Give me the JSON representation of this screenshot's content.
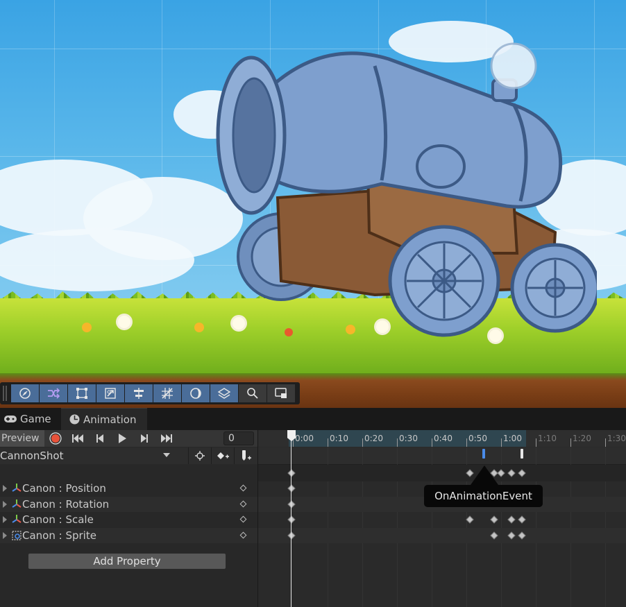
{
  "tabs": {
    "game_label": "Game",
    "animation_label": "Animation"
  },
  "scene_toolbar": {
    "tools": [
      "view-tool-icon",
      "move-tool-icon",
      "rect-tool-icon",
      "transform-tool-icon",
      "align-tool-icon",
      "grid-snap-icon",
      "shading-icon",
      "layers-icon",
      "search-icon",
      "camera-overlay-icon"
    ]
  },
  "animation": {
    "preview_label": "Preview",
    "frame_value": "0",
    "clip_name": "CannonShot",
    "properties": [
      {
        "label": "Canon : Position"
      },
      {
        "label": "Canon : Rotation"
      },
      {
        "label": "Canon : Scale"
      },
      {
        "label": "Canon : Sprite"
      }
    ],
    "add_property_label": "Add Property",
    "ruler_labels": [
      "0:00",
      "0:10",
      "0:20",
      "0:30",
      "0:40",
      "0:50",
      "1:00",
      "1:10",
      "1:20",
      "1:30"
    ],
    "tooltip": "OnAnimationEvent"
  },
  "colors": {
    "accent_blue": "#4a6d99",
    "record_red": "#e8523a",
    "event_marker_blue": "#4a8be8"
  }
}
